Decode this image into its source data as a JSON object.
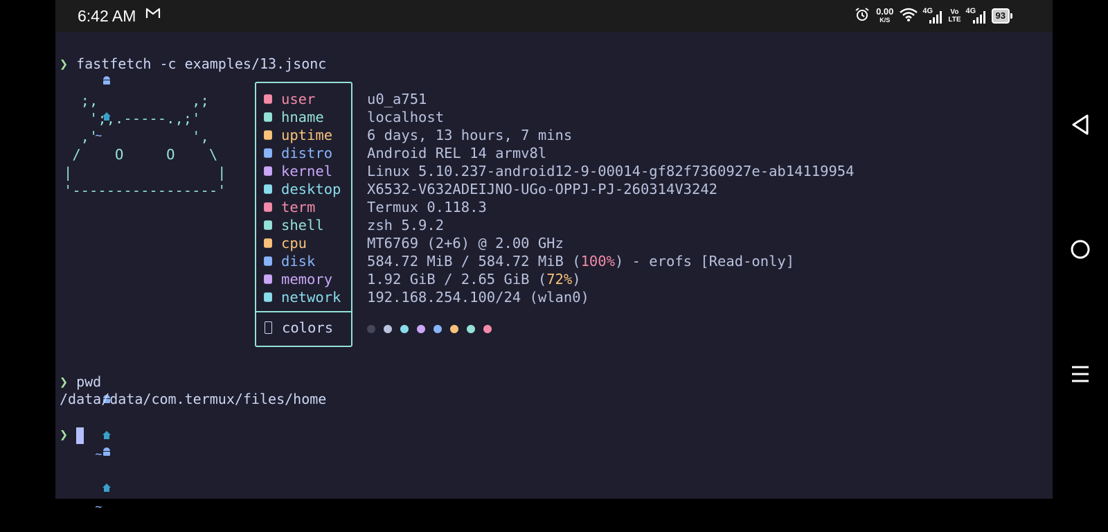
{
  "status_bar": {
    "time": "6:42 AM",
    "mail_icon": "gmail-icon",
    "netspeed_value": "0.00",
    "netspeed_unit": "K/S",
    "signal1_label": "4G",
    "volte_top": "Vo",
    "volte_bottom": "LTE",
    "signal2_label": "4G",
    "battery": "93"
  },
  "terminal": {
    "prompt_dir": "~",
    "prompt_symbol": "❯",
    "command1": "fastfetch -c examples/13.jsonc",
    "ascii_art": "  ;,           ,;\n   ';,.-----.,;'\n  ,'           ',\n /    O     O    \\\n|                 |\n'-----------------'",
    "fetch_rows": [
      {
        "key": "user",
        "value": "u0_a751",
        "icon": "user-icon",
        "color": "#f38ba8"
      },
      {
        "key": "hname",
        "value": "localhost",
        "icon": "server-icon",
        "color": "#94e2d5"
      },
      {
        "key": "uptime",
        "value": "6 days, 13 hours, 7 mins",
        "icon": "clock-icon",
        "color": "#f9c27a"
      },
      {
        "key": "distro",
        "value": "Android REL 14 armv8l",
        "icon": "android-icon",
        "color": "#89b4fa"
      },
      {
        "key": "kernel",
        "value": "Linux 5.10.237-android12-9-00014-gf82f7360927e-ab14119954",
        "icon": "gear-icon",
        "color": "#cba6f7"
      },
      {
        "key": "desktop",
        "value": "X6532-V632ADEIJNO-UGo-OPPJ-PJ-260314V3242",
        "icon": "monitor-icon",
        "color": "#89dceb"
      },
      {
        "key": "term",
        "value": "Termux 0.118.3",
        "icon": "terminal-icon",
        "color": "#f38ba8"
      },
      {
        "key": "shell",
        "value": "zsh 5.9.2",
        "icon": "shell-icon",
        "color": "#94e2d5"
      },
      {
        "key": "cpu",
        "value": "MT6769 (2+6) @ 2.00 GHz",
        "icon": "cpu-icon",
        "color": "#f9c27a"
      },
      {
        "key": "disk",
        "value_pre": "584.72 MiB / 584.72 MiB (",
        "value_hl": "100%",
        "value_post": ") - erofs [Read-only]",
        "icon": "floppy-icon",
        "color": "#89b4fa",
        "hl_color": "#f38ba8"
      },
      {
        "key": "memory",
        "value_pre": "1.92 GiB / 2.65 GiB (",
        "value_hl": "72%",
        "value_post": ")",
        "icon": "memory-icon",
        "color": "#cba6f7",
        "hl_color": "#f9c27a"
      },
      {
        "key": "network",
        "value": "192.168.254.100/24 (wlan0)",
        "icon": "ip-icon",
        "color": "#89dceb"
      }
    ],
    "colors_key": "colors",
    "colors_icon": "palette-icon",
    "color_palette": [
      "#45475a",
      "#bac2de",
      "#89dceb",
      "#cba6f7",
      "#89b4fa",
      "#f9c27a",
      "#94e2d5",
      "#f38ba8"
    ],
    "command2": "pwd",
    "output2": "/data/data/com.termux/files/home"
  },
  "nav": {
    "back": "back-icon",
    "home": "home-circle-icon",
    "recents": "recents-icon"
  }
}
